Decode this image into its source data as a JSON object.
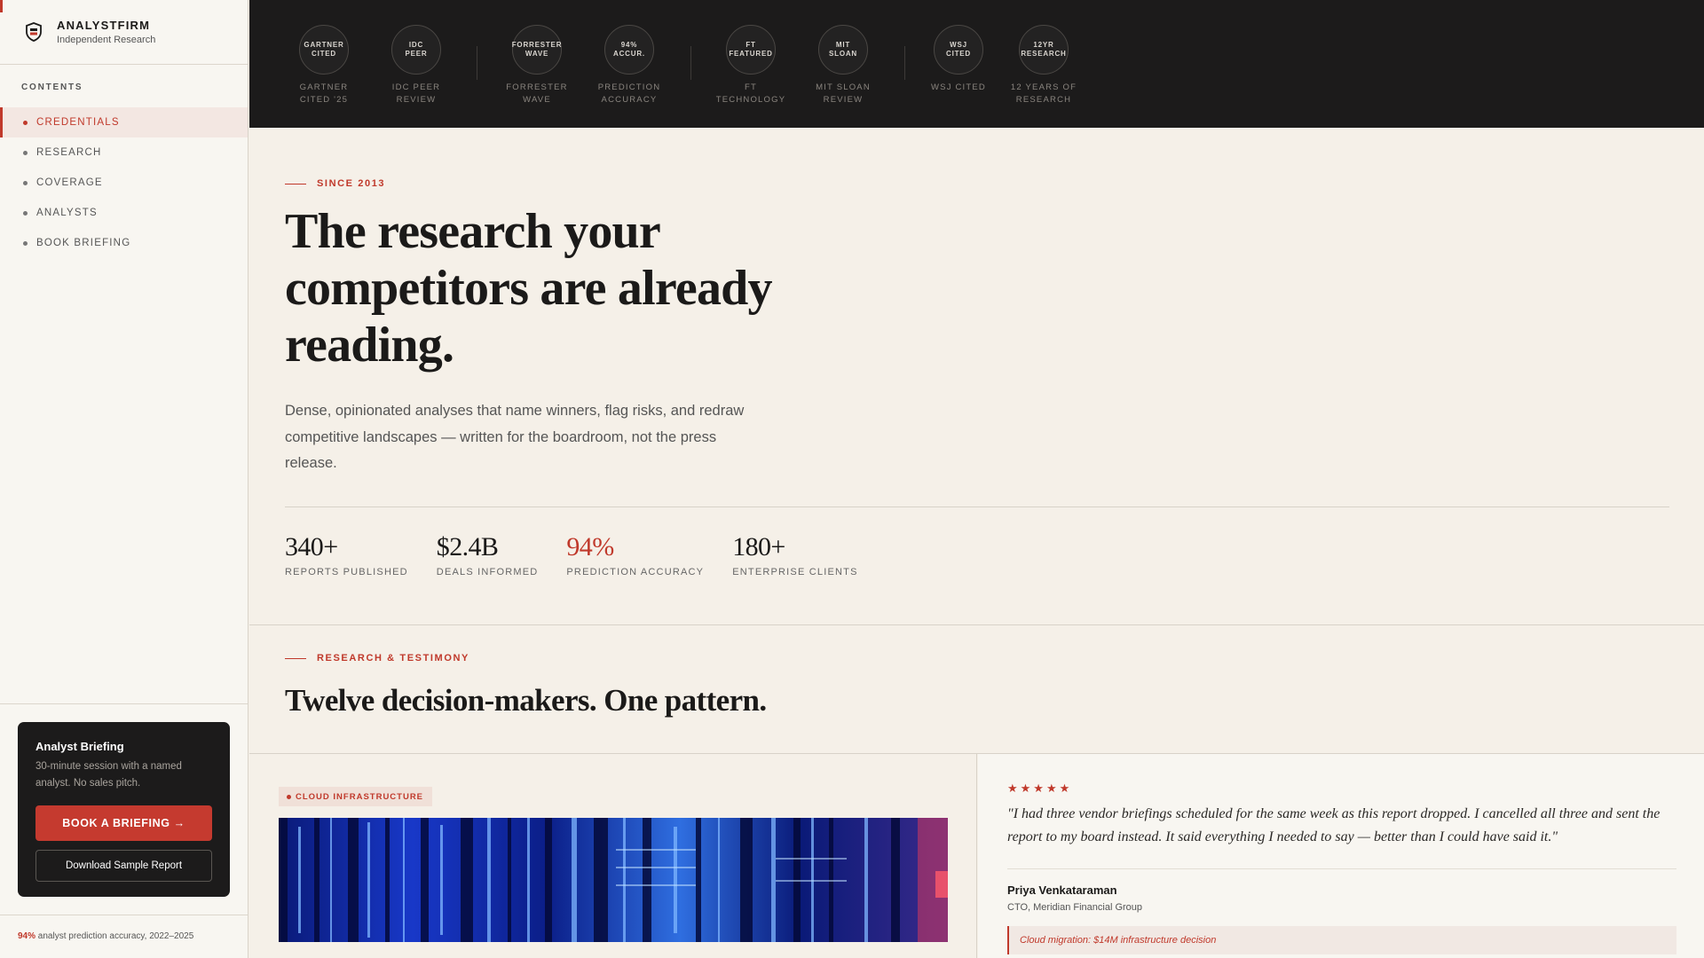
{
  "sidebar": {
    "brand_name": "ANALYSTFIRM",
    "brand_tagline": "Independent Research",
    "contents_label": "CONTENTS",
    "nav": [
      {
        "label": "CREDENTIALS",
        "active": true
      },
      {
        "label": "RESEARCH",
        "active": false
      },
      {
        "label": "COVERAGE",
        "active": false
      },
      {
        "label": "ANALYSTS",
        "active": false
      },
      {
        "label": "BOOK BRIEFING",
        "active": false
      }
    ],
    "briefing": {
      "title": "Analyst Briefing",
      "description": "30-minute session with a named analyst. No sales pitch.",
      "book_label": "BOOK A BRIEFING →",
      "sample_label": "Download Sample Report"
    },
    "footer": {
      "accuracy_value": "94%",
      "accuracy_text": "analyst prediction accuracy, 2022–2025"
    }
  },
  "badges": [
    {
      "circle": "GARTNER\nCITED",
      "caption": "GARTNER\nCITED '25"
    },
    {
      "circle": "IDC\nPEER",
      "caption": "IDC PEER\nREVIEW"
    },
    {
      "circle": "FORRESTER\nWAVE",
      "caption": "FORRESTER\nWAVE"
    },
    {
      "circle": "94%\nACCUR.",
      "caption": "PREDICTION\nACCURACY"
    },
    {
      "circle": "FT\nFEATURED",
      "caption": "FT\nTECHNOLOGY"
    },
    {
      "circle": "MIT\nSLOAN",
      "caption": "MIT SLOAN\nREVIEW"
    },
    {
      "circle": "WSJ\nCITED",
      "caption": "WSJ CITED"
    },
    {
      "circle": "12YR\nRESEARCH",
      "caption": "12 YEARS OF\nRESEARCH"
    }
  ],
  "hero": {
    "eyebrow": "SINCE 2013",
    "title": "The research your competitors are already reading.",
    "description": "Dense, opinionated analyses that name winners, flag risks, and redraw competitive landscapes — written for the boardroom, not the press release.",
    "stats": [
      {
        "value": "340+",
        "label": "REPORTS PUBLISHED",
        "accent": false
      },
      {
        "value": "$2.4B",
        "label": "DEALS INFORMED",
        "accent": false
      },
      {
        "value": "94%",
        "label": "PREDICTION ACCURACY",
        "accent": true
      },
      {
        "value": "180+",
        "label": "ENTERPRISE CLIENTS",
        "accent": false
      }
    ]
  },
  "research": {
    "eyebrow": "RESEARCH & TESTIMONY",
    "title": "Twelve decision-makers. One pattern.",
    "card": {
      "tag": "CLOUD INFRASTRUCTURE",
      "stars": "★★★★★",
      "rating": 5,
      "quote": "\"I had three vendor briefings scheduled for the same week as this report dropped. I cancelled all three and sent the report to my board instead. It said everything I needed to say — better than I could have said it.\"",
      "name": "Priya Venkataraman",
      "role": "CTO, Meridian Financial Group",
      "decision": "Cloud migration: $14M infrastructure decision"
    }
  },
  "colors": {
    "accent": "#c0392b",
    "dark": "#1c1b1b",
    "paper": "#f5f0e8"
  }
}
